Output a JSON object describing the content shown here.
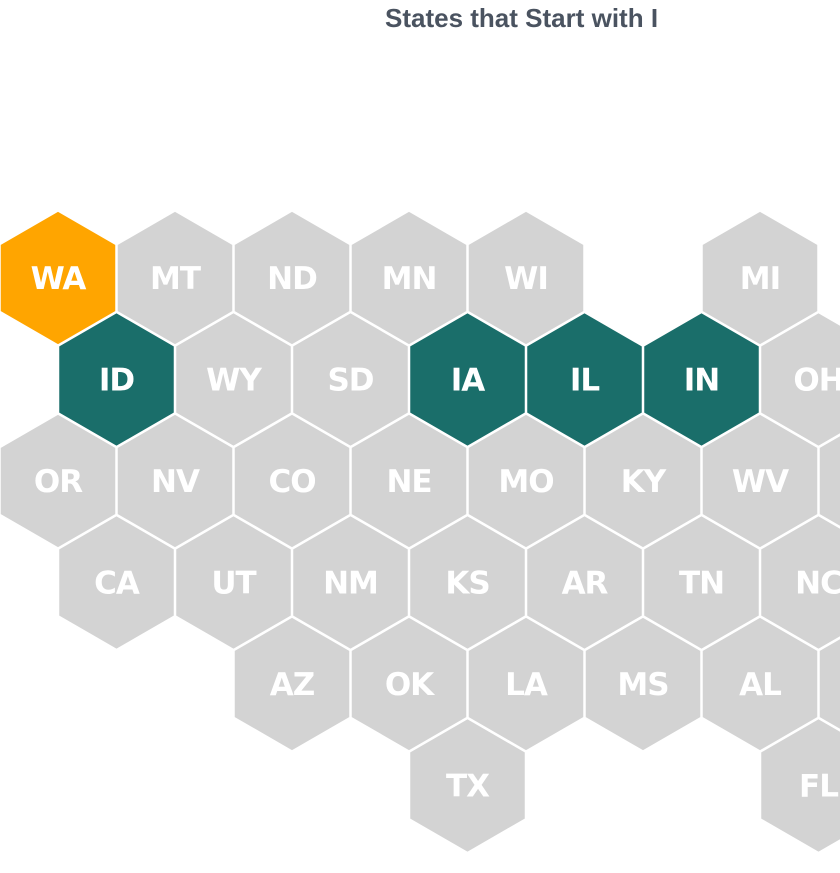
{
  "chart_data": {
    "type": "heatmap",
    "subtype": "hex-tile-map",
    "title": "States that Start with I",
    "colors": {
      "highlight": "#FFA500",
      "starts_with_i": "#1A6E6A",
      "other": "#D3D3D3",
      "label": "#FFFFFF",
      "title": "#4A5360"
    },
    "legend": null,
    "tiles": [
      {
        "state": "WA",
        "row": 0,
        "col": 0,
        "category": "highlight"
      },
      {
        "state": "MT",
        "row": 0,
        "col": 1,
        "category": "other"
      },
      {
        "state": "ND",
        "row": 0,
        "col": 2,
        "category": "other"
      },
      {
        "state": "MN",
        "row": 0,
        "col": 3,
        "category": "other"
      },
      {
        "state": "WI",
        "row": 0,
        "col": 4,
        "category": "other"
      },
      {
        "state": "MI",
        "row": 0,
        "col": 6,
        "category": "other"
      },
      {
        "state": "ID",
        "row": 1,
        "col": 0,
        "category": "starts_with_i"
      },
      {
        "state": "WY",
        "row": 1,
        "col": 1,
        "category": "other"
      },
      {
        "state": "SD",
        "row": 1,
        "col": 2,
        "category": "other"
      },
      {
        "state": "IA",
        "row": 1,
        "col": 3,
        "category": "starts_with_i"
      },
      {
        "state": "IL",
        "row": 1,
        "col": 4,
        "category": "starts_with_i"
      },
      {
        "state": "IN",
        "row": 1,
        "col": 5,
        "category": "starts_with_i"
      },
      {
        "state": "OH",
        "row": 1,
        "col": 6,
        "category": "other"
      },
      {
        "state": "OR",
        "row": 2,
        "col": 0,
        "category": "other"
      },
      {
        "state": "NV",
        "row": 2,
        "col": 1,
        "category": "other"
      },
      {
        "state": "CO",
        "row": 2,
        "col": 2,
        "category": "other"
      },
      {
        "state": "NE",
        "row": 2,
        "col": 3,
        "category": "other"
      },
      {
        "state": "MO",
        "row": 2,
        "col": 4,
        "category": "other"
      },
      {
        "state": "KY",
        "row": 2,
        "col": 5,
        "category": "other"
      },
      {
        "state": "WV",
        "row": 2,
        "col": 6,
        "category": "other"
      },
      {
        "state": "",
        "row": 2,
        "col": 7,
        "category": "other"
      },
      {
        "state": "CA",
        "row": 3,
        "col": 0,
        "category": "other"
      },
      {
        "state": "UT",
        "row": 3,
        "col": 1,
        "category": "other"
      },
      {
        "state": "NM",
        "row": 3,
        "col": 2,
        "category": "other"
      },
      {
        "state": "KS",
        "row": 3,
        "col": 3,
        "category": "other"
      },
      {
        "state": "AR",
        "row": 3,
        "col": 4,
        "category": "other"
      },
      {
        "state": "TN",
        "row": 3,
        "col": 5,
        "category": "other"
      },
      {
        "state": "NC",
        "row": 3,
        "col": 6,
        "category": "other"
      },
      {
        "state": "AZ",
        "row": 4,
        "col": 2,
        "category": "other"
      },
      {
        "state": "OK",
        "row": 4,
        "col": 3,
        "category": "other"
      },
      {
        "state": "LA",
        "row": 4,
        "col": 4,
        "category": "other"
      },
      {
        "state": "MS",
        "row": 4,
        "col": 5,
        "category": "other"
      },
      {
        "state": "AL",
        "row": 4,
        "col": 6,
        "category": "other"
      },
      {
        "state": "",
        "row": 4,
        "col": 7,
        "category": "other"
      },
      {
        "state": "TX",
        "row": 5,
        "col": 3,
        "category": "other"
      },
      {
        "state": "FL",
        "row": 5,
        "col": 6,
        "category": "other"
      }
    ]
  }
}
